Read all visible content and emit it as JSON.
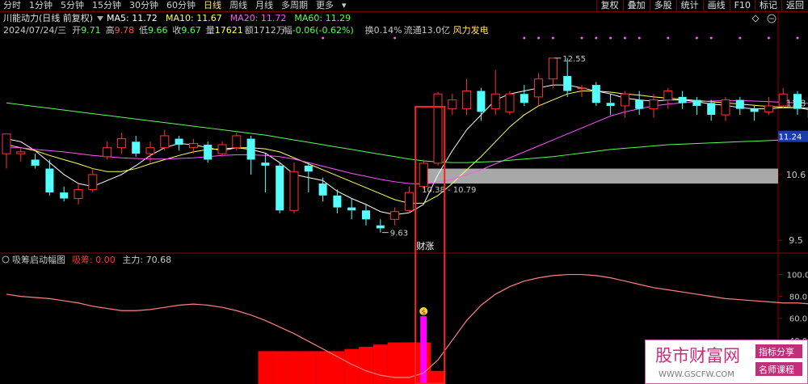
{
  "toolbar": {
    "periods": [
      "分时",
      "1分钟",
      "5分钟",
      "15分钟",
      "30分钟",
      "60分钟",
      "日线",
      "周线",
      "月线",
      "多周期",
      "更多"
    ],
    "active_period": "日线",
    "buttons": [
      "复权",
      "叠加",
      "多股",
      "统计",
      "画线",
      "F10",
      "标记",
      "返回"
    ]
  },
  "header": {
    "stock_name": "川能动力(日线 前复权)",
    "ma": [
      {
        "label": "MA5: 11.72",
        "color": "#ffffff"
      },
      {
        "label": "MA10: 11.67",
        "color": "#ffff55"
      },
      {
        "label": "MA20: 11.72",
        "color": "#ff55ff"
      },
      {
        "label": "MA60: 11.29",
        "color": "#55ff55"
      }
    ],
    "date": "2024/07/24/三",
    "quote": [
      {
        "k": "开",
        "v": "9.71",
        "vc": "#55ff55"
      },
      {
        "k": "高",
        "v": "9.78",
        "vc": "#ff5555"
      },
      {
        "k": "低",
        "v": "9.66",
        "vc": "#55ff55"
      },
      {
        "k": "收",
        "v": "9.67",
        "vc": "#55ff55"
      },
      {
        "k": "量",
        "v": "17621",
        "vc": "#ffff55"
      },
      {
        "k": "额",
        "v": "1712万",
        "vc": "#c8c8c8"
      },
      {
        "k": "幅",
        "v": "-0.06(-0.62%)",
        "vc": "#55ff55"
      },
      {
        "k": "换",
        "v": "0.14%",
        "vc": "#c8c8c8"
      },
      {
        "k": "流通",
        "v": "13.0亿",
        "vc": "#c8c8c8"
      }
    ],
    "sector": "风力发电"
  },
  "indicator_header": {
    "name": "吸筹启动幅图",
    "items": [
      {
        "label": "吸筹: 0.00",
        "color": "#ff3333"
      },
      {
        "label": "主力: 70.68",
        "color": "#c8c8c8"
      }
    ]
  },
  "chart_data": [
    {
      "type": "candlestick",
      "ylim": [
        9.3,
        12.9
      ],
      "y_ticks": [
        9.5,
        10.6,
        11.8
      ],
      "last_price_label": "11.24",
      "candles": [
        [
          10.95,
          11.28,
          11.28,
          10.7
        ],
        [
          10.95,
          10.98,
          11.05,
          10.82
        ],
        [
          10.85,
          10.75,
          10.95,
          10.7
        ],
        [
          10.7,
          10.3,
          10.85,
          10.25
        ],
        [
          10.3,
          10.2,
          10.4,
          10.15
        ],
        [
          10.2,
          10.35,
          10.45,
          10.1
        ],
        [
          10.35,
          10.6,
          10.7,
          10.3
        ],
        [
          10.9,
          11.05,
          11.15,
          10.85
        ],
        [
          11.05,
          11.2,
          11.3,
          10.95
        ],
        [
          11.15,
          10.95,
          11.25,
          10.9
        ],
        [
          10.95,
          11.05,
          11.15,
          10.8
        ],
        [
          11.05,
          11.25,
          11.35,
          11.0
        ],
        [
          11.2,
          11.1,
          11.25,
          11.0
        ],
        [
          11.05,
          11.12,
          11.2,
          10.95
        ],
        [
          11.1,
          10.85,
          11.15,
          10.8
        ],
        [
          10.95,
          11.1,
          11.15,
          10.9
        ],
        [
          11.05,
          11.25,
          11.3,
          11.0
        ],
        [
          11.2,
          10.85,
          11.25,
          10.6
        ],
        [
          10.8,
          10.75,
          10.95,
          10.3
        ],
        [
          10.75,
          10.0,
          10.8,
          9.95
        ],
        [
          10.0,
          10.65,
          10.8,
          9.95
        ],
        [
          10.75,
          10.65,
          10.8,
          10.3
        ],
        [
          10.45,
          10.25,
          10.55,
          10.15
        ],
        [
          10.25,
          10.05,
          10.35,
          9.95
        ],
        [
          10.05,
          10.0,
          10.2,
          9.85
        ],
        [
          10.0,
          9.85,
          10.1,
          9.75
        ],
        [
          9.75,
          9.7,
          9.85,
          9.63
        ],
        [
          9.85,
          9.98,
          10.05,
          9.75
        ],
        [
          10.0,
          10.3,
          10.4,
          9.95
        ],
        [
          10.4,
          10.79,
          10.85,
          10.35
        ],
        [
          10.79,
          11.95,
          11.98,
          10.75
        ],
        [
          11.7,
          11.85,
          11.95,
          11.6
        ],
        [
          11.7,
          12.0,
          12.2,
          11.6
        ],
        [
          12.0,
          11.65,
          12.05,
          11.5
        ],
        [
          11.7,
          11.95,
          12.35,
          11.6
        ],
        [
          11.65,
          11.95,
          12.0,
          11.6
        ],
        [
          11.95,
          11.8,
          12.1,
          11.75
        ],
        [
          11.9,
          12.2,
          12.3,
          11.75
        ],
        [
          12.2,
          12.55,
          12.55,
          12.05
        ],
        [
          12.25,
          12.0,
          12.55,
          11.9
        ],
        [
          12.05,
          12.05,
          12.1,
          11.9
        ],
        [
          12.1,
          11.8,
          12.15,
          11.75
        ],
        [
          11.8,
          11.75,
          11.95,
          11.6
        ],
        [
          11.75,
          11.95,
          12.0,
          11.55
        ],
        [
          11.85,
          11.7,
          12.0,
          11.6
        ],
        [
          11.7,
          11.85,
          11.95,
          11.55
        ],
        [
          11.85,
          12.0,
          12.05,
          11.7
        ],
        [
          11.9,
          11.8,
          12.0,
          11.7
        ],
        [
          11.85,
          11.75,
          11.9,
          11.6
        ],
        [
          11.8,
          11.6,
          11.85,
          11.5
        ],
        [
          11.6,
          11.85,
          11.9,
          11.5
        ],
        [
          11.85,
          11.7,
          11.9,
          11.6
        ],
        [
          11.7,
          11.65,
          11.75,
          11.5
        ],
        [
          11.65,
          11.75,
          11.9,
          11.6
        ],
        [
          11.75,
          11.95,
          12.05,
          11.7
        ],
        [
          11.95,
          11.7,
          12.0,
          11.6
        ],
        [
          11.7,
          11.55,
          11.75,
          11.5
        ],
        [
          11.6,
          11.75,
          11.8,
          11.5
        ],
        [
          11.75,
          11.7,
          11.8,
          11.6
        ],
        [
          11.7,
          11.6,
          11.8,
          11.55
        ],
        [
          11.6,
          11.65,
          11.7,
          11.55
        ],
        [
          11.65,
          11.6,
          11.75,
          11.45
        ],
        [
          11.55,
          11.6,
          11.65,
          11.5
        ],
        [
          11.55,
          11.6,
          11.65,
          11.45
        ],
        [
          11.6,
          11.75,
          11.8,
          11.55
        ],
        [
          11.7,
          11.8,
          11.85,
          11.6
        ],
        [
          11.8,
          11.85,
          11.9,
          11.65
        ],
        [
          11.85,
          11.82,
          11.95,
          11.7
        ],
        [
          11.78,
          11.55,
          11.95,
          11.5
        ]
      ],
      "ma": [
        {
          "name": "MA5",
          "color": "#ffffff",
          "values": [
            11.2,
            11.15,
            11.0,
            10.8,
            10.6,
            10.45,
            10.4,
            10.5,
            10.6,
            10.75,
            10.92,
            11.05,
            11.12,
            11.1,
            11.05,
            11.0,
            11.05,
            11.02,
            10.96,
            10.8,
            10.6,
            10.55,
            10.5,
            10.32,
            10.2,
            10.1,
            9.98,
            9.93,
            9.96,
            10.1,
            10.6,
            11.0,
            11.35,
            11.6,
            11.85,
            11.95,
            12.0,
            12.05,
            12.1,
            12.1,
            12.05,
            12.0,
            11.95,
            11.88,
            11.85,
            11.83,
            11.85,
            11.85,
            11.82,
            11.78,
            11.76,
            11.72,
            11.7,
            11.7,
            11.72,
            11.72,
            11.68,
            11.66,
            11.66,
            11.67,
            11.66,
            11.64,
            11.62,
            11.62,
            11.64,
            11.67,
            11.7,
            11.74,
            11.72
          ]
        },
        {
          "name": "MA10",
          "color": "#ffff55",
          "values": [
            11.1,
            11.05,
            11.0,
            10.92,
            10.85,
            10.78,
            10.7,
            10.65,
            10.65,
            10.7,
            10.78,
            10.85,
            10.92,
            10.98,
            11.02,
            11.03,
            11.05,
            11.05,
            11.03,
            10.98,
            10.88,
            10.78,
            10.68,
            10.58,
            10.48,
            10.38,
            10.28,
            10.18,
            10.12,
            10.12,
            10.25,
            10.45,
            10.68,
            10.9,
            11.15,
            11.4,
            11.6,
            11.75,
            11.85,
            11.95,
            12.0,
            12.0,
            11.98,
            11.95,
            11.93,
            11.9,
            11.88,
            11.86,
            11.84,
            11.82,
            11.8,
            11.78,
            11.76,
            11.74,
            11.73,
            11.72,
            11.71,
            11.7,
            11.69,
            11.69,
            11.68,
            11.67,
            11.66,
            11.65,
            11.65,
            11.65,
            11.66,
            11.67,
            11.67
          ]
        },
        {
          "name": "MA20",
          "color": "#ff55ff",
          "values": [
            11.05,
            11.05,
            11.02,
            11.0,
            10.98,
            10.95,
            10.92,
            10.9,
            10.88,
            10.87,
            10.86,
            10.86,
            10.87,
            10.88,
            10.9,
            10.92,
            10.93,
            10.93,
            10.92,
            10.9,
            10.86,
            10.8,
            10.74,
            10.68,
            10.62,
            10.57,
            10.52,
            10.48,
            10.45,
            10.44,
            10.47,
            10.52,
            10.6,
            10.68,
            10.78,
            10.88,
            10.98,
            11.08,
            11.18,
            11.28,
            11.38,
            11.48,
            11.58,
            11.65,
            11.7,
            11.75,
            11.78,
            11.8,
            11.82,
            11.83,
            11.84,
            11.84,
            11.83,
            11.82,
            11.81,
            11.8,
            11.79,
            11.78,
            11.77,
            11.76,
            11.75,
            11.74,
            11.73,
            11.72,
            11.71,
            11.71,
            11.71,
            11.72,
            11.72
          ]
        },
        {
          "name": "MA60",
          "color": "#55ff55",
          "values": [
            11.8,
            11.77,
            11.74,
            11.71,
            11.68,
            11.65,
            11.62,
            11.59,
            11.56,
            11.53,
            11.5,
            11.47,
            11.44,
            11.41,
            11.38,
            11.35,
            11.32,
            11.29,
            11.26,
            11.22,
            11.18,
            11.14,
            11.1,
            11.06,
            11.02,
            10.98,
            10.94,
            10.9,
            10.86,
            10.83,
            10.81,
            10.8,
            10.8,
            10.81,
            10.82,
            10.84,
            10.86,
            10.88,
            10.9,
            10.93,
            10.96,
            10.99,
            11.02,
            11.04,
            11.06,
            11.08,
            11.1,
            11.11,
            11.12,
            11.13,
            11.14,
            11.15,
            11.16,
            11.17,
            11.18,
            11.19,
            11.2,
            11.2,
            11.21,
            11.22,
            11.22,
            11.23,
            11.24,
            11.24,
            11.25,
            11.26,
            11.27,
            11.28,
            11.29
          ]
        }
      ],
      "annotations": [
        {
          "text": "12.55",
          "index": 38,
          "price": 12.55
        },
        {
          "text": "9.63",
          "index": 26,
          "price": 9.63
        },
        {
          "text": "10.38 - 10.79",
          "index": 29,
          "price": 10.38
        },
        {
          "text": "财涨",
          "index": 29
        }
      ],
      "highlight_zone": {
        "from_index": 29,
        "price_low": 10.45,
        "price_high": 10.7
      },
      "signal_index": 29,
      "top_dots_indices": [
        22,
        27,
        36,
        37,
        38,
        40,
        41,
        42,
        43,
        44,
        46,
        48,
        49,
        51,
        53,
        55,
        58,
        61,
        64,
        66
      ]
    },
    {
      "type": "bar_line",
      "title": "吸筹启动幅图",
      "ylim": [
        0,
        110
      ],
      "y_ticks": [
        20,
        40,
        60,
        80,
        100
      ],
      "series": [
        {
          "name": "主力",
          "type": "line",
          "color": "#ff8080",
          "values": [
            82,
            80,
            79,
            78,
            76,
            74,
            71,
            69,
            67,
            67,
            68,
            70,
            72,
            73,
            72,
            70,
            67,
            63,
            58,
            52,
            46,
            39,
            32,
            25,
            18,
            12,
            8,
            6,
            6,
            10,
            22,
            40,
            58,
            72,
            82,
            89,
            94,
            97,
            99,
            100,
            100,
            99,
            97,
            94,
            91,
            88,
            86,
            84,
            82,
            80,
            78,
            77,
            76,
            75,
            74,
            74,
            73,
            72,
            71,
            70,
            69,
            68,
            67,
            67,
            67,
            68,
            70,
            71,
            70
          ]
        },
        {
          "name": "吸筹",
          "type": "bar",
          "color": "#ff0000",
          "values": [
            0,
            0,
            0,
            0,
            0,
            0,
            0,
            0,
            0,
            0,
            0,
            0,
            0,
            0,
            0,
            0,
            0,
            0,
            30,
            30,
            30,
            30,
            30,
            30,
            32,
            34,
            36,
            38,
            38,
            38,
            12,
            0,
            0,
            0,
            0,
            0,
            0,
            0,
            0,
            0,
            0,
            0,
            0,
            0,
            0,
            0,
            0,
            0,
            0,
            0,
            0,
            0,
            0,
            0,
            0,
            0,
            0,
            0,
            0,
            0,
            0,
            0,
            0,
            0,
            0,
            0,
            0,
            0,
            0
          ]
        }
      ],
      "spike": {
        "index": 29,
        "value": 62,
        "color": "#ff00ff"
      },
      "spike_marker": "$"
    }
  ],
  "watermark": {
    "name": "股市财富网",
    "url": "WWW.GSCFW.COM",
    "tag1": "指标分享",
    "tag2": "名师课程"
  }
}
